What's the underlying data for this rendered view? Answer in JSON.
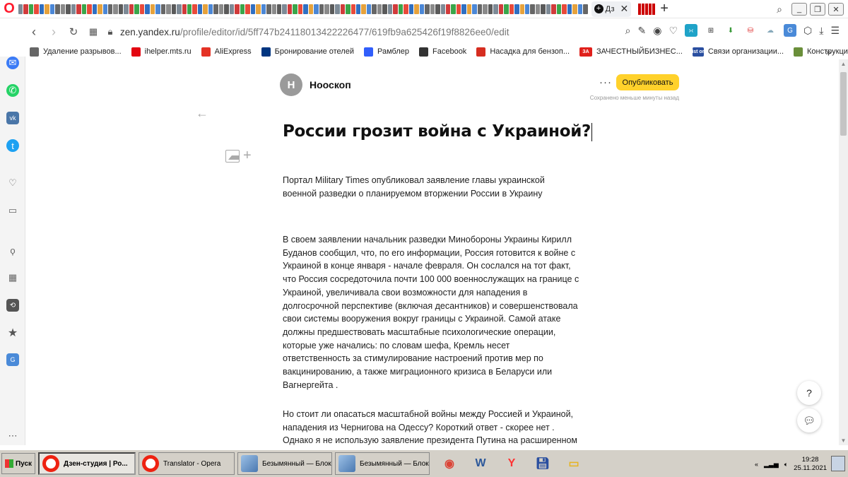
{
  "browser": {
    "active_tab_label": "Дз",
    "url_host": "zen.yandex.ru",
    "url_path": "/profile/editor/id/5ff747b24118013422226477/619fb9a625426f19f8826ee0/edit"
  },
  "bookmarks": [
    {
      "label": "Удаление разрывов...",
      "icon": "page-icon",
      "color": "#666666"
    },
    {
      "label": "ihelper.mts.ru",
      "icon": "mts-icon",
      "color": "#e30611"
    },
    {
      "label": "AliExpress",
      "icon": "aliexpress-icon",
      "color": "#e43225"
    },
    {
      "label": "Бронирование отелей",
      "icon": "booking-icon",
      "color": "#003580"
    },
    {
      "label": "Рамблер",
      "icon": "rambler-icon",
      "color": "#315efb"
    },
    {
      "label": "Facebook",
      "icon": "page-icon",
      "color": "#333333"
    },
    {
      "label": "Насадка для бензоп...",
      "icon": "pin-icon",
      "color": "#d62d20"
    },
    {
      "label": "ЗАЧЕСТНЫЙБИЗНЕС...",
      "icon": "za-icon",
      "color": "#e0201b",
      "icon_text": "ЗА"
    },
    {
      "label": "Связи организации...",
      "icon": "list-org-icon",
      "color": "#2a4fa0",
      "icon_text": "List org"
    },
    {
      "label": "Конструкция теплог...",
      "icon": "link-icon",
      "color": "#6a8f3a"
    }
  ],
  "editor": {
    "channel_avatar_letter": "Н",
    "channel_name": "Нооскоп",
    "publish_label": "Опубликовать",
    "saved_status": "Сохранено меньше минуты назад",
    "article_title": "России грозит война с Украиной?",
    "paragraphs": [
      "Портал Military Times опубликовал заявление главы украинской военной разведки о планируемом вторжении России в Украину",
      "В своем заявлении начальник разведки Минобороны Украины Кирилл Буданов сообщил, что, по его информации, Россия готовится к войне с Украиной в конце января - начале февраля. Он сослался на тот факт, что Россия сосредоточила почти 100 000 военнослужащих на границе с Украиной, увеличивала свои возможности для нападения в долгосрочной перспективе (включая десантников) и совершенствовала свои системы вооружения вокруг границы с Украиной. Самой атаке должны предшествовать масштабные психологические операции, которые уже начались: по словам шефа, Кремль несет ответственность за стимулирование настроений против мер по вакцинированию, а также миграционного кризиса в Беларуси или Вагнергейта .",
      "Но стоит ли опасаться масштабной войны между Россией и Украиной, нападения из Чернигова на Одессу? Короткий ответ - скорее нет . Однако я не использую заявление президента Путина на расширенном заседании"
    ],
    "help_label": "?"
  },
  "taskbar": {
    "start_label": "Пуск",
    "tasks": [
      {
        "label": "Дзен-студия | Ро...",
        "active": true,
        "icon": "opera-icon"
      },
      {
        "label": "Translator - Opera",
        "active": false,
        "icon": "opera-icon"
      },
      {
        "label": "Безымянный — Блок...",
        "active": false,
        "icon": "notepad-icon"
      },
      {
        "label": "Безымянный — Блок...",
        "active": false,
        "icon": "notepad-icon"
      }
    ],
    "quick_launch": [
      "chrome-icon",
      "word-icon",
      "yandex-browser-icon",
      "save-icon",
      "folder-icon"
    ],
    "tray_symbol": "«",
    "clock_time": "19:28",
    "clock_date": "25.11.2021"
  },
  "colors": {
    "publish_button": "#ffd12b",
    "opera_red": "#ff1b2d",
    "taskbar": "#d4d0c8"
  }
}
